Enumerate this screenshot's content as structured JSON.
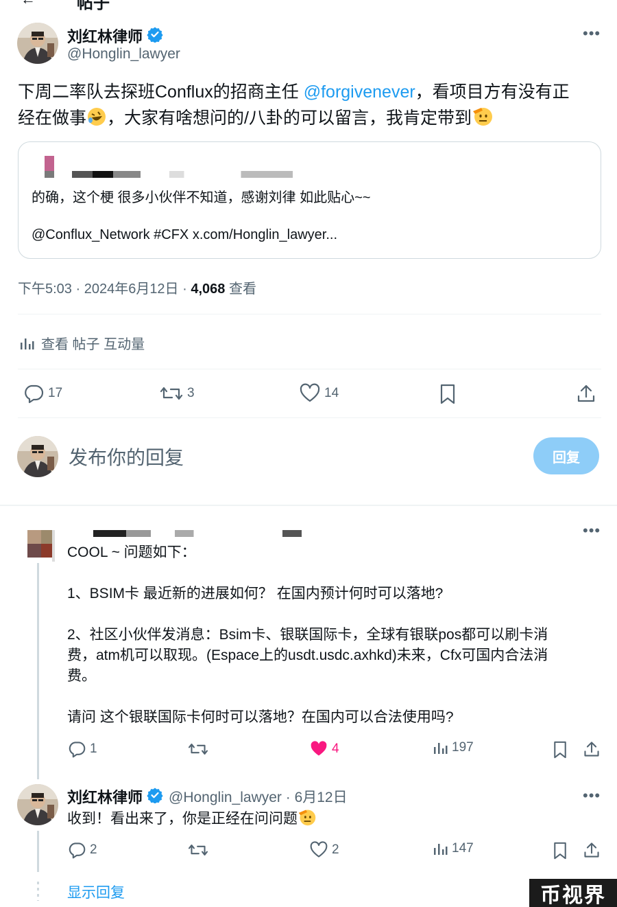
{
  "header": {
    "title": "帖子"
  },
  "main_tweet": {
    "author_name": "刘红林律师",
    "author_handle": "@Honglin_lawyer",
    "text_part1": "下周二率队去探班Conflux的招商主任 ",
    "mention": "@forgivenever",
    "text_part2": "，看项目方有没有正",
    "text_line2": "经在做事",
    "text_line2b": "，大家有啥想问的/八卦的可以留言，我肯定带到",
    "quote": {
      "line1": "的确，这个梗 很多小伙伴不知道，感谢刘律 如此贴心~~",
      "line2": "@Conflux_Network #CFX x.com/Honglin_lawyer..."
    },
    "time": "下午5:03 · 2024年6月12日 · ",
    "views_count": "4,068",
    "views_label": " 查看",
    "engagement_label": "查看 帖子 互动量",
    "actions": {
      "replies": "17",
      "retweets": "3",
      "likes": "14"
    }
  },
  "reply_box": {
    "placeholder": "发布你的回复",
    "button": "回复"
  },
  "reply1": {
    "line1": "COOL ~ 问题如下：",
    "line2": "1、BSIM卡 最近新的进展如何？ 在国内预计何时可以落地?",
    "line3": "2、社区小伙伴发消息：Bsim卡、银联国际卡，全球有银联pos都可以刷卡消",
    "line4": "费，atm机可以取现。(Espace上的usdt.usdc.axhkd)未来，Cfx可国内合法消",
    "line5": "费。",
    "line6": "请问 这个银联国际卡何时可以落地？在国内可以合法使用吗?",
    "actions": {
      "replies": "1",
      "likes": "4",
      "views": "197"
    }
  },
  "reply2": {
    "author_name": "刘红林律师",
    "author_handle": "@Honglin_lawyer · 6月12日",
    "text": "收到！看出来了，你是正经在问问题",
    "actions": {
      "replies": "2",
      "likes": "2",
      "views": "147"
    }
  },
  "show_replies": "显示回复",
  "watermark": "币视界",
  "colors": {
    "accent": "#1d9bf0",
    "like_active": "#f91880",
    "muted": "#536471"
  }
}
